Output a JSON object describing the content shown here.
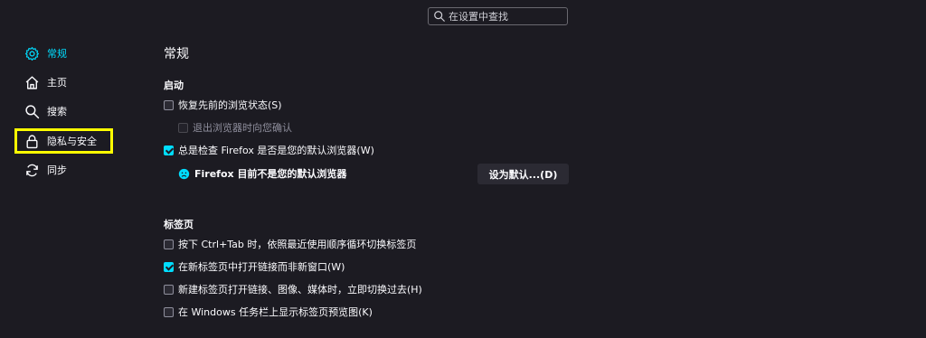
{
  "search": {
    "placeholder": "在设置中查找",
    "icon": "search-icon"
  },
  "sidebar": {
    "items": [
      {
        "label": "常规",
        "icon": "gear-icon",
        "selected": true
      },
      {
        "label": "主页",
        "icon": "home-icon",
        "selected": false
      },
      {
        "label": "搜索",
        "icon": "search-icon",
        "selected": false
      },
      {
        "label": "隐私与安全",
        "icon": "lock-icon",
        "selected": false
      },
      {
        "label": "同步",
        "icon": "sync-icon",
        "selected": false
      }
    ]
  },
  "main": {
    "title": "常规",
    "startup": {
      "heading": "启动",
      "restore_session": {
        "label": "恢复先前的浏览状态(S)",
        "checked": false
      },
      "warn_on_quit": {
        "label": "退出浏览器时向您确认",
        "checked": false,
        "disabled": true
      },
      "check_default": {
        "label": "总是检查 Firefox 是否是您的默认浏览器(W)",
        "checked": true
      },
      "not_default_text": "Firefox 目前不是您的默认浏览器",
      "set_default_button": "设为默认...(D)"
    },
    "tabs": {
      "heading": "标签页",
      "options": [
        {
          "label": "按下 Ctrl+Tab 时，依照最近使用顺序循环切换标签页",
          "checked": false
        },
        {
          "label": "在新标签页中打开链接而非新窗口(W)",
          "checked": true
        },
        {
          "label": "新建标签页打开链接、图像、媒体时，立即切换过去(H)",
          "checked": false
        },
        {
          "label": "在 Windows 任务栏上显示标签页预览图(K)",
          "checked": false
        }
      ]
    }
  },
  "colors": {
    "accent": "#00ddff",
    "background": "#1c1b22",
    "highlight": "#ffff00"
  }
}
